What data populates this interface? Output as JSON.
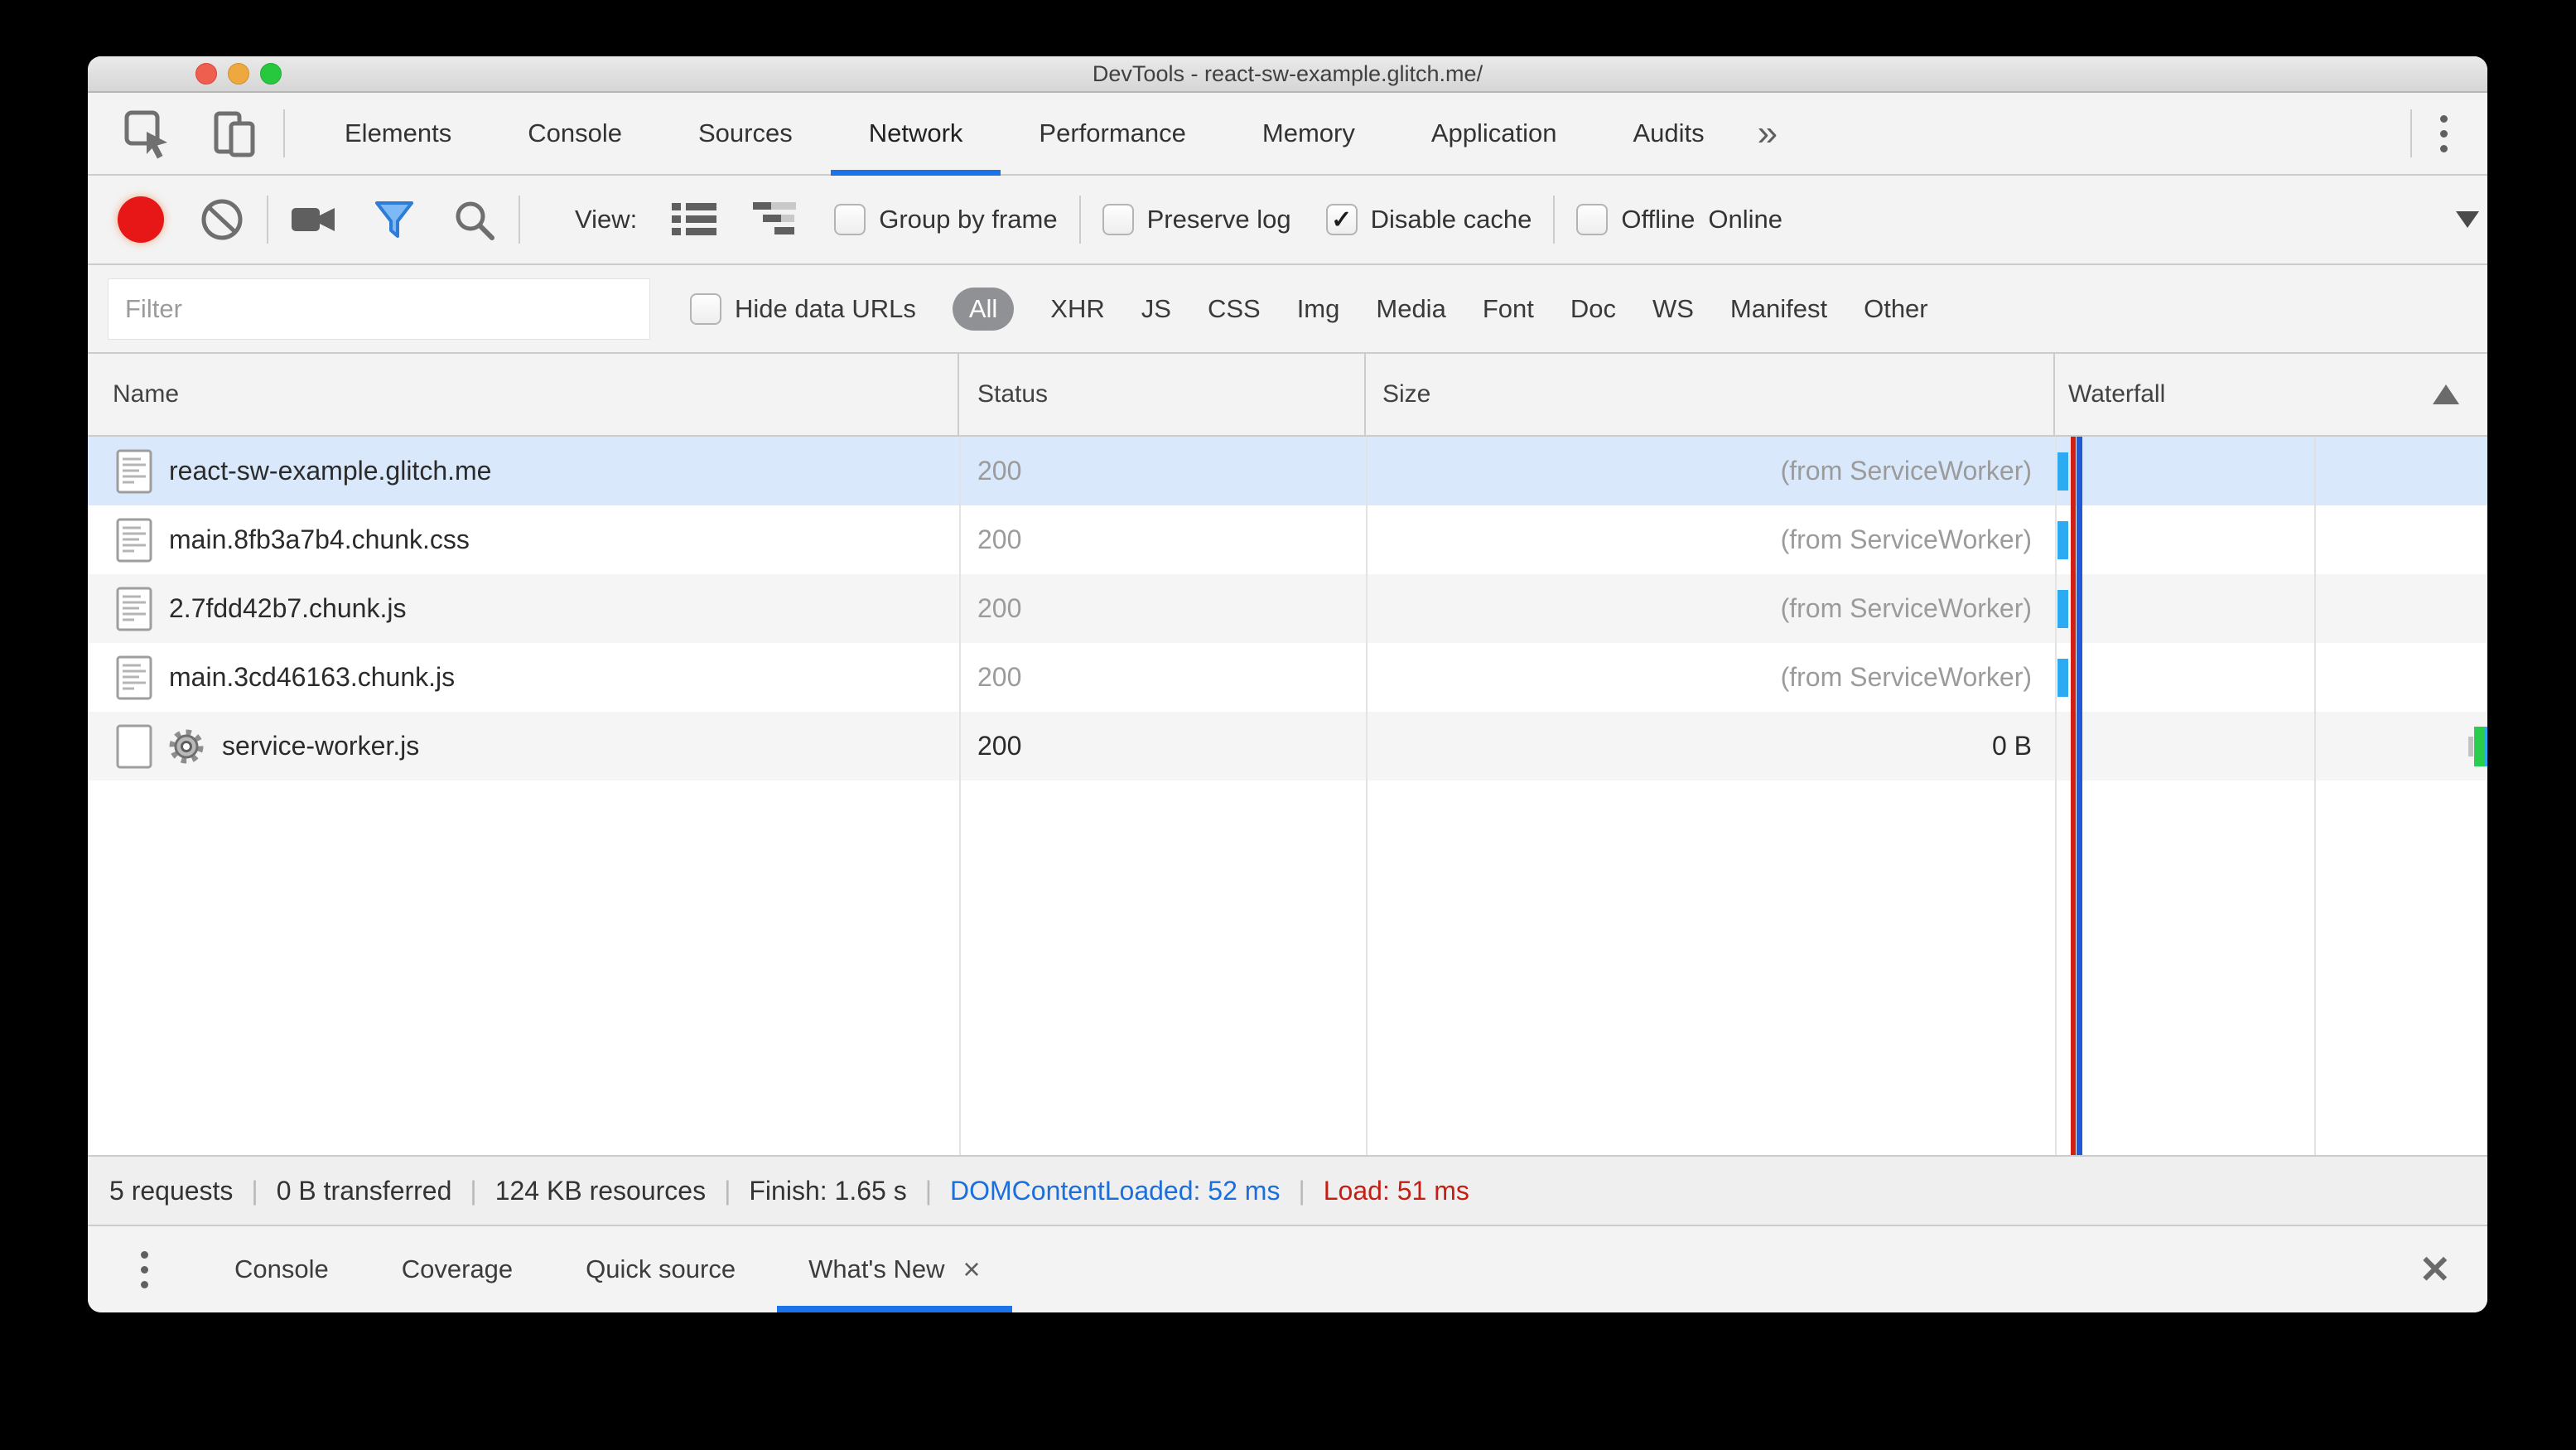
{
  "titlebar": {
    "title": "DevTools - react-sw-example.glitch.me/"
  },
  "tabbar": {
    "overflow": "»",
    "tabs": [
      {
        "label": "Elements"
      },
      {
        "label": "Console"
      },
      {
        "label": "Sources"
      },
      {
        "label": "Network",
        "active": true
      },
      {
        "label": "Performance"
      },
      {
        "label": "Memory"
      },
      {
        "label": "Application"
      },
      {
        "label": "Audits"
      }
    ]
  },
  "toolbar": {
    "view_label": "View:",
    "group_by_frame": {
      "label": "Group by frame",
      "checked": false
    },
    "preserve_log": {
      "label": "Preserve log",
      "checked": false
    },
    "disable_cache": {
      "label": "Disable cache",
      "checked": true
    },
    "offline": {
      "label": "Offline",
      "checked": false
    },
    "throttling_value": "Online",
    "check_glyph": "✓"
  },
  "filterbar": {
    "filter_placeholder": "Filter",
    "hide_data_urls": {
      "label": "Hide data URLs",
      "checked": false
    },
    "check_glyph": "✓",
    "type_filters": [
      {
        "label": "All",
        "active": true
      },
      {
        "label": "XHR"
      },
      {
        "label": "JS"
      },
      {
        "label": "CSS"
      },
      {
        "label": "Img"
      },
      {
        "label": "Media"
      },
      {
        "label": "Font"
      },
      {
        "label": "Doc"
      },
      {
        "label": "WS"
      },
      {
        "label": "Manifest"
      },
      {
        "label": "Other"
      }
    ]
  },
  "table": {
    "columns": {
      "name": "Name",
      "status": "Status",
      "size": "Size",
      "waterfall": "Waterfall"
    },
    "rows": [
      {
        "icon": "icon-document",
        "name": "react-sw-example.glitch.me",
        "status": "200",
        "size": "(from ServiceWorker)",
        "selected": true,
        "muted": true,
        "wf": "wf-blue"
      },
      {
        "icon": "icon-document",
        "name": "main.8fb3a7b4.chunk.css",
        "status": "200",
        "size": "(from ServiceWorker)",
        "muted": true,
        "wf": "wf-blue"
      },
      {
        "icon": "icon-document",
        "name": "2.7fdd42b7.chunk.js",
        "status": "200",
        "size": "(from ServiceWorker)",
        "muted": true,
        "wf": "wf-blue"
      },
      {
        "icon": "icon-document",
        "name": "main.3cd46163.chunk.js",
        "status": "200",
        "size": "(from ServiceWorker)",
        "muted": true,
        "wf": "wf-blue"
      },
      {
        "icon": "icon-gear",
        "name": "service-worker.js",
        "status": "200",
        "size": "0 B",
        "muted": false,
        "wf": "wf-green"
      }
    ]
  },
  "summary": {
    "items": [
      {
        "text": "5 requests"
      },
      {
        "text": "0 B transferred"
      },
      {
        "text": "124 KB resources"
      },
      {
        "text": "Finish: 1.65 s"
      },
      {
        "text": "DOMContentLoaded: 52 ms",
        "cls": "blue"
      },
      {
        "text": "Load: 51 ms",
        "cls": "red"
      }
    ]
  },
  "drawer": {
    "tabs": [
      {
        "label": "Console"
      },
      {
        "label": "Coverage"
      },
      {
        "label": "Quick source"
      },
      {
        "label": "What's New",
        "active": true,
        "closable": true
      }
    ],
    "tab_close_glyph": "×",
    "close_glyph": "✕"
  },
  "colors": {
    "accent_blue": "#1a73e8",
    "dcl_text_blue": "#1a6fdc",
    "load_text_red": "#c51f14",
    "waterfall_bar_blue": "#2caaf2",
    "waterfall_bar_green": "#28ce4c",
    "dcl_marker_blue": "#2257d6",
    "load_marker_red": "#d21f16",
    "selected_row_bg": "#d9e8fb",
    "record_red": "#e81717"
  }
}
